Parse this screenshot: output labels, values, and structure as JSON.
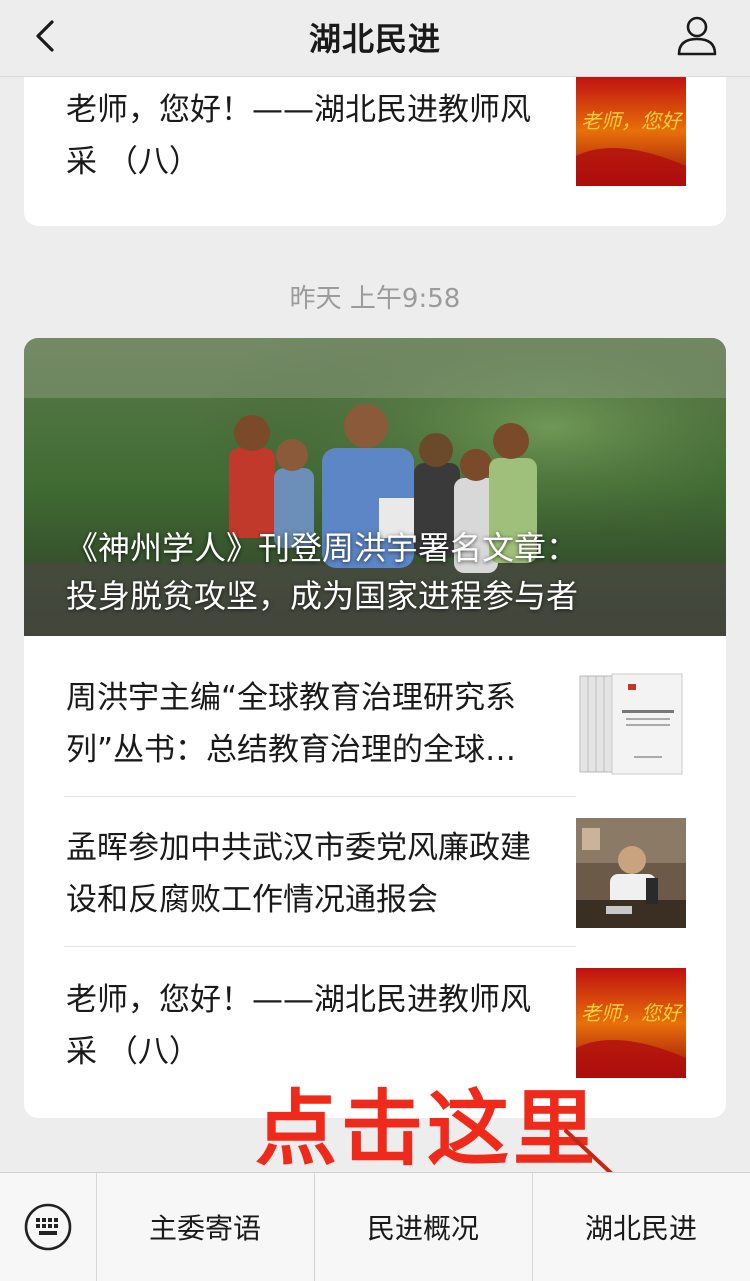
{
  "header": {
    "title": "湖北民进"
  },
  "card_top": {
    "item_text": "老师，您好！——湖北民进教师风采 （八）",
    "thumb_text": "老师，您好"
  },
  "timestamp": "昨天 上午9:58",
  "main_card": {
    "cover_title_line1": "《神州学人》刊登周洪宇署名文章：",
    "cover_title_line2": "投身脱贫攻坚，成为国家进程参与者",
    "items": [
      {
        "text": "周洪宇主编“全球教育治理研究系列”丛书：总结教育治理的全球…",
        "thumb": "book-cover"
      },
      {
        "text": "孟晖参加中共武汉市委党风廉政建设和反腐败工作情况通报会",
        "thumb": "meeting-photo"
      },
      {
        "text": "老师，您好！——湖北民进教师风采 （八）",
        "thumb": "老师，您好"
      }
    ]
  },
  "annotation": {
    "text": "点击这里"
  },
  "menu": {
    "items": [
      {
        "label": "主委寄语"
      },
      {
        "label": "民进概况"
      },
      {
        "label": "湖北民进"
      }
    ]
  },
  "colors": {
    "annotation_red": "#f02a1b",
    "bg": "#ededed"
  }
}
